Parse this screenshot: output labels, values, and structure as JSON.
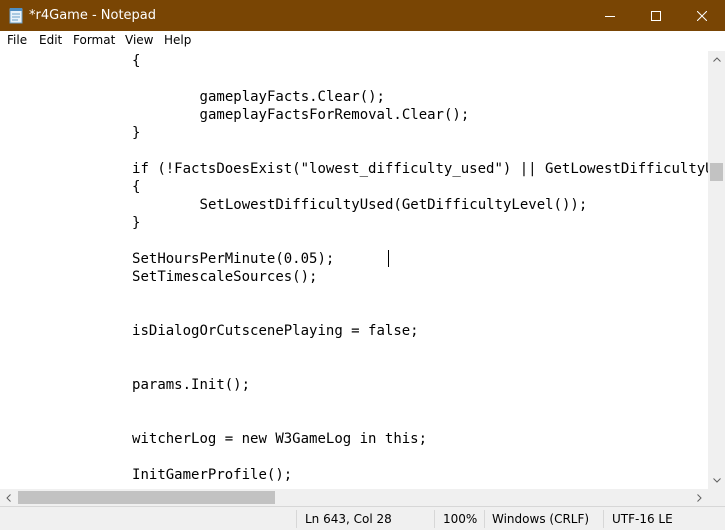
{
  "window": {
    "title": "*r4Game - Notepad",
    "titlebar_color": "#794504",
    "icons": {
      "app": "notepad-icon",
      "minimize": "minimize-icon",
      "maximize": "maximize-icon",
      "close": "close-icon"
    }
  },
  "menu": {
    "file": "File",
    "edit": "Edit",
    "format": "Format",
    "view": "View",
    "help": "Help"
  },
  "editor": {
    "lines": [
      "\t\t{",
      "",
      "\t\t\tgameplayFacts.Clear();",
      "\t\t\tgameplayFactsForRemoval.Clear();",
      "\t\t}",
      "",
      "\t\tif (!FactsDoesExist(\"lowest_difficulty_used\") || GetLowestDifficultyUsed",
      "\t\t{",
      "\t\t\tSetLowestDifficultyUsed(GetDifficultyLevel());",
      "\t\t}",
      "",
      "\t\tSetHoursPerMinute(0.05);",
      "\t\tSetTimescaleSources();",
      "",
      "",
      "\t\tisDialogOrCutscenePlaying = false;",
      "",
      "",
      "\t\tparams.Init();",
      "",
      "",
      "\t\twitcherLog = new W3GameLog in this;",
      "",
      "\t\tInitGamerProfile();"
    ]
  },
  "statusbar": {
    "position": "Ln 643, Col 28",
    "zoom": "100%",
    "line_endings": "Windows (CRLF)",
    "encoding": "UTF-16 LE"
  }
}
